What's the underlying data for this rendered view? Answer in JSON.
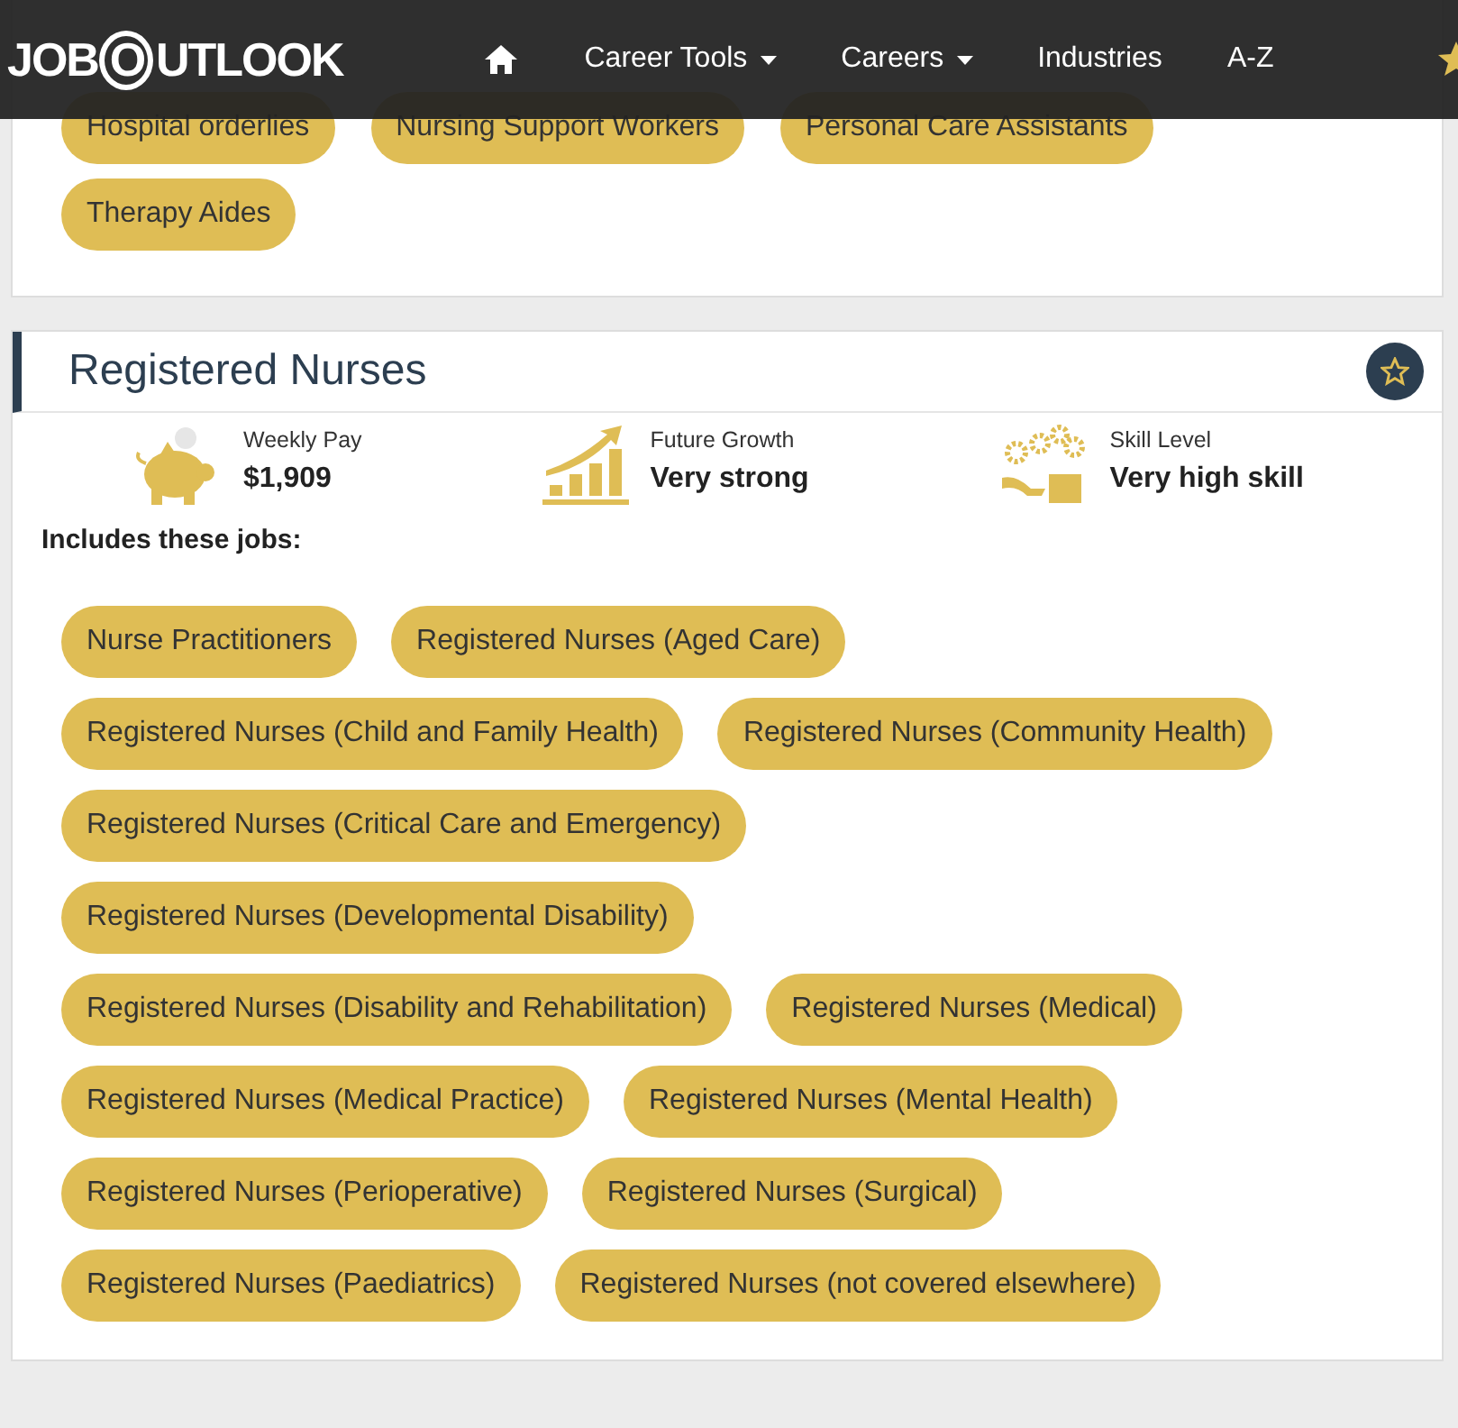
{
  "navbar": {
    "logo": "JOBOUTLOOK",
    "items": [
      {
        "kind": "home"
      },
      {
        "kind": "dropdown",
        "label": "Career Tools"
      },
      {
        "kind": "dropdown",
        "label": "Careers"
      },
      {
        "kind": "link",
        "label": "Industries"
      },
      {
        "kind": "link",
        "label": "A-Z"
      },
      {
        "kind": "star"
      }
    ]
  },
  "previous_card": {
    "jobs": [
      "Hospital orderlies",
      "Nursing Support Workers",
      "Personal Care Assistants",
      "Therapy Aides"
    ]
  },
  "occupation": {
    "title": "Registered Nurses",
    "favourite": false,
    "stats": [
      {
        "kind": "pay",
        "label": "Weekly Pay",
        "value": "$1,909"
      },
      {
        "kind": "growth",
        "label": "Future Growth",
        "value": "Very strong"
      },
      {
        "kind": "skill",
        "label": "Skill Level",
        "value": "Very high skill"
      }
    ],
    "jobs_heading": "Includes these jobs:",
    "jobs": [
      "Nurse Practitioners",
      "Registered Nurses (Aged Care)",
      "Registered Nurses (Child and Family Health)",
      "Registered Nurses (Community Health)",
      "Registered Nurses (Critical Care and Emergency)",
      "Registered Nurses (Developmental Disability)",
      "Registered Nurses (Disability and Rehabilitation)",
      "Registered Nurses (Medical)",
      "Registered Nurses (Medical Practice)",
      "Registered Nurses (Mental Health)",
      "Registered Nurses (Perioperative)",
      "Registered Nurses (Surgical)",
      "Registered Nurses (Paediatrics)",
      "Registered Nurses (not covered elsewhere)"
    ]
  }
}
